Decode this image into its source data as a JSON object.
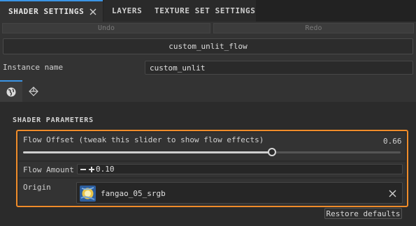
{
  "tabs": [
    {
      "label": "SHADER SETTINGS",
      "active": true
    },
    {
      "label": "LAYERS",
      "active": false
    },
    {
      "label": "TEXTURE SET SETTINGS",
      "active": false
    }
  ],
  "toolbar": {
    "undo_label": "Undo",
    "redo_label": "Redo"
  },
  "shader": {
    "selected": "custom_unlit_flow"
  },
  "instance": {
    "label": "Instance name",
    "value": "custom_unlit"
  },
  "icon_tabs": [
    {
      "icon": "globe-icon",
      "active": true
    },
    {
      "icon": "cube-icon",
      "active": false
    }
  ],
  "parameters": {
    "section_title": "SHADER PARAMETERS",
    "flow_offset": {
      "label": "Flow Offset (tweak this slider to show flow effects)",
      "value_text": "0.66",
      "value": 0.66
    },
    "flow_amount": {
      "label": "Flow Amount",
      "value": "0.10"
    },
    "origin": {
      "label": "Origin",
      "resource": "fangao_05_srgb"
    }
  },
  "restore_label": "Restore defaults",
  "colors": {
    "accent": "#3b95e6",
    "highlight": "#f08c2a"
  }
}
